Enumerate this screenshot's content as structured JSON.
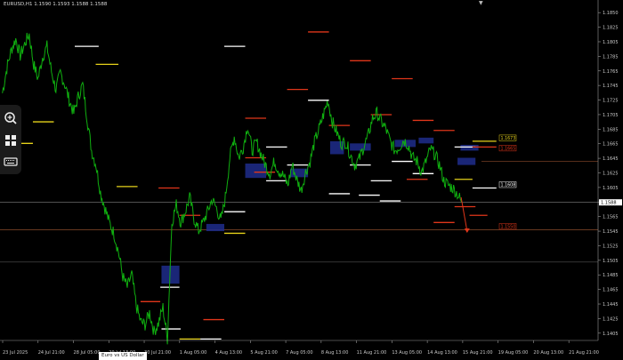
{
  "chart_title": "EURUSD,H1  1.1590 1.1593 1.1588 1.1588",
  "tooltip": "Euro vs US Dollar",
  "colors": {
    "background": "#000000",
    "price_line": "#10b010",
    "zone_fill": "#1e2d8c",
    "axis_text": "#c8c8c8",
    "grid_line": "#808080",
    "yellow_level": "#e6d21a",
    "red_level": "#e0361a",
    "white_level": "#ffffff"
  },
  "toolbar": {
    "icons": [
      "zoom-in-icon",
      "grid-icon",
      "keyboard-icon"
    ]
  },
  "chart_data": {
    "type": "line",
    "symbol": "EURUSD",
    "timeframe": "H1",
    "ohlc": {
      "open": 1.159,
      "high": 1.1593,
      "low": 1.1588,
      "close": 1.1588
    },
    "ylim": [
      1.1396,
      1.1862
    ],
    "y_ticks": [
      "1.1850",
      "1.1825",
      "1.1805",
      "1.1785",
      "1.1765",
      "1.1745",
      "1.1725",
      "1.1705",
      "1.1685",
      "1.1665",
      "1.1645",
      "1.1625",
      "1.1605",
      "1.1585",
      "1.1565",
      "1.1545",
      "1.1525",
      "1.1505",
      "1.1485",
      "1.1465",
      "1.1445",
      "1.1425",
      "1.1405"
    ],
    "x_labels": [
      "23 Jul 2025",
      "24 Jul 21:00",
      "28 Jul 05:00",
      "29 Jul 13:00",
      "30 Jul 21:00",
      "1 Aug 05:00",
      "4 Aug 13:00",
      "5 Aug 21:00",
      "7 Aug 05:00",
      "8 Aug 13:00",
      "11 Aug 21:00",
      "13 Aug 05:00",
      "14 Aug 13:00",
      "15 Aug 21:00",
      "19 Aug 05:00",
      "20 Aug 13:00",
      "21 Aug 21:00"
    ],
    "price_labels": [
      {
        "value": 1.1673,
        "text": "1.1673",
        "color": "#e6d21a"
      },
      {
        "value": 1.1665,
        "text": "1.1665",
        "color": "#e0361a"
      },
      {
        "value": 1.1608,
        "text": "1.1608",
        "color": "#ffffff"
      },
      {
        "value": 1.1588,
        "text": "1.1588",
        "color": "#ffffff"
      },
      {
        "value": 1.155,
        "text": "1.1550",
        "color": "#e0361a"
      }
    ],
    "series": [
      {
        "values": [
          1.174,
          1.1775,
          1.18,
          1.1815,
          1.1792,
          1.1808,
          1.1822,
          1.178,
          1.176,
          1.179,
          1.1805,
          1.177,
          1.1745,
          1.1768,
          1.1752,
          1.173,
          1.1712,
          1.1735,
          1.1752,
          1.1705,
          1.166,
          1.164,
          1.1602,
          1.158,
          1.156,
          1.1545,
          1.152,
          1.1485,
          1.147,
          1.1488,
          1.1445,
          1.1422,
          1.1418,
          1.1435,
          1.1408,
          1.142,
          1.1442,
          1.1398,
          1.156,
          1.1585,
          1.156,
          1.1575,
          1.1595,
          1.1565,
          1.1548,
          1.156,
          1.1575,
          1.1592,
          1.158,
          1.1562,
          1.1595,
          1.165,
          1.168,
          1.165,
          1.1665,
          1.1695,
          1.166,
          1.1672,
          1.1655,
          1.164,
          1.1628,
          1.1645,
          1.1632,
          1.1625,
          1.1612,
          1.164,
          1.162,
          1.1605,
          1.163,
          1.1645,
          1.1672,
          1.169,
          1.171,
          1.173,
          1.17,
          1.1685,
          1.167,
          1.1672,
          1.1655,
          1.164,
          1.1648,
          1.1665,
          1.168,
          1.1705,
          1.1712,
          1.17,
          1.169,
          1.1672,
          1.166,
          1.1665,
          1.1675,
          1.1668,
          1.165,
          1.1645,
          1.163,
          1.1645,
          1.1662,
          1.1655,
          1.164,
          1.1618,
          1.1612,
          1.1608,
          1.16,
          1.1588
        ]
      }
    ],
    "zones": [
      {
        "start": 0.41,
        "end": 0.445,
        "low": 1.1622,
        "high": 1.1642
      },
      {
        "start": 0.485,
        "end": 0.515,
        "low": 1.1623,
        "high": 1.1635
      },
      {
        "start": 0.552,
        "end": 0.575,
        "low": 1.1655,
        "high": 1.1673
      },
      {
        "start": 0.585,
        "end": 0.62,
        "low": 1.166,
        "high": 1.167
      },
      {
        "start": 0.66,
        "end": 0.695,
        "low": 1.1665,
        "high": 1.1675
      },
      {
        "start": 0.7,
        "end": 0.725,
        "low": 1.167,
        "high": 1.1678
      },
      {
        "start": 0.77,
        "end": 0.8,
        "low": 1.166,
        "high": 1.1668
      },
      {
        "start": 0.345,
        "end": 0.375,
        "low": 1.1548,
        "high": 1.1558
      },
      {
        "start": 0.27,
        "end": 0.3,
        "low": 1.1475,
        "high": 1.15
      },
      {
        "start": 0.765,
        "end": 0.795,
        "low": 1.164,
        "high": 1.165
      }
    ],
    "levels": [
      {
        "start": 0.125,
        "end": 0.165,
        "value": 1.1805,
        "color": "#ffffff"
      },
      {
        "start": 0.16,
        "end": 0.198,
        "value": 1.178,
        "color": "#e6d21a"
      },
      {
        "start": 0.055,
        "end": 0.09,
        "value": 1.17,
        "color": "#e6d21a"
      },
      {
        "start": 0.025,
        "end": 0.055,
        "value": 1.167,
        "color": "#e6d21a"
      },
      {
        "start": 0.195,
        "end": 0.23,
        "value": 1.161,
        "color": "#e6d21a"
      },
      {
        "start": 0.265,
        "end": 0.3,
        "value": 1.1608,
        "color": "#e0361a"
      },
      {
        "start": 0.3,
        "end": 0.335,
        "value": 1.157,
        "color": "#e0361a"
      },
      {
        "start": 0.235,
        "end": 0.268,
        "value": 1.145,
        "color": "#e0361a"
      },
      {
        "start": 0.268,
        "end": 0.3,
        "value": 1.147,
        "color": "#ffffff"
      },
      {
        "start": 0.27,
        "end": 0.302,
        "value": 1.1412,
        "color": "#ffffff"
      },
      {
        "start": 0.34,
        "end": 0.375,
        "value": 1.1425,
        "color": "#e0361a"
      },
      {
        "start": 0.3,
        "end": 0.335,
        "value": 1.1398,
        "color": "#e6d21a"
      },
      {
        "start": 0.335,
        "end": 0.37,
        "value": 1.1398,
        "color": "#ffffff"
      },
      {
        "start": 0.375,
        "end": 0.41,
        "value": 1.1545,
        "color": "#e6d21a"
      },
      {
        "start": 0.375,
        "end": 0.41,
        "value": 1.1575,
        "color": "#ffffff"
      },
      {
        "start": 0.375,
        "end": 0.41,
        "value": 1.1805,
        "color": "#ffffff"
      },
      {
        "start": 0.41,
        "end": 0.445,
        "value": 1.165,
        "color": "#e0361a"
      },
      {
        "start": 0.41,
        "end": 0.445,
        "value": 1.1705,
        "color": "#e0361a"
      },
      {
        "start": 0.445,
        "end": 0.48,
        "value": 1.1618,
        "color": "#ffffff"
      },
      {
        "start": 0.445,
        "end": 0.48,
        "value": 1.1665,
        "color": "#ffffff"
      },
      {
        "start": 0.48,
        "end": 0.515,
        "value": 1.1745,
        "color": "#e0361a"
      },
      {
        "start": 0.48,
        "end": 0.515,
        "value": 1.164,
        "color": "#ffffff"
      },
      {
        "start": 0.515,
        "end": 0.55,
        "value": 1.1825,
        "color": "#e0361a"
      },
      {
        "start": 0.515,
        "end": 0.55,
        "value": 1.173,
        "color": "#ffffff"
      },
      {
        "start": 0.55,
        "end": 0.585,
        "value": 1.1695,
        "color": "#e0361a"
      },
      {
        "start": 0.55,
        "end": 0.585,
        "value": 1.16,
        "color": "#ffffff"
      },
      {
        "start": 0.585,
        "end": 0.62,
        "value": 1.1785,
        "color": "#e0361a"
      },
      {
        "start": 0.585,
        "end": 0.62,
        "value": 1.164,
        "color": "#ffffff"
      },
      {
        "start": 0.62,
        "end": 0.655,
        "value": 1.171,
        "color": "#e0361a"
      },
      {
        "start": 0.62,
        "end": 0.655,
        "value": 1.1618,
        "color": "#ffffff"
      },
      {
        "start": 0.655,
        "end": 0.69,
        "value": 1.176,
        "color": "#e0361a"
      },
      {
        "start": 0.655,
        "end": 0.69,
        "value": 1.1645,
        "color": "#ffffff"
      },
      {
        "start": 0.69,
        "end": 0.725,
        "value": 1.1702,
        "color": "#e0361a"
      },
      {
        "start": 0.69,
        "end": 0.725,
        "value": 1.1628,
        "color": "#ffffff"
      },
      {
        "start": 0.725,
        "end": 0.76,
        "value": 1.156,
        "color": "#e0361a"
      },
      {
        "start": 0.725,
        "end": 0.76,
        "value": 1.1688,
        "color": "#e0361a"
      },
      {
        "start": 0.76,
        "end": 0.795,
        "value": 1.1665,
        "color": "#ffffff"
      },
      {
        "start": 0.76,
        "end": 0.795,
        "value": 1.1582,
        "color": "#e0361a"
      },
      {
        "start": 0.425,
        "end": 0.46,
        "value": 1.163,
        "color": "#e0361a"
      },
      {
        "start": 0.6,
        "end": 0.635,
        "value": 1.1598,
        "color": "#ffffff"
      },
      {
        "start": 0.635,
        "end": 0.67,
        "value": 1.159,
        "color": "#ffffff"
      },
      {
        "start": 0.68,
        "end": 0.715,
        "value": 1.162,
        "color": "#e0361a"
      },
      {
        "start": 0.76,
        "end": 0.79,
        "value": 1.162,
        "color": "#e6d21a"
      },
      {
        "start": 0.79,
        "end": 0.83,
        "value": 1.1673,
        "color": "#e6d21a"
      },
      {
        "start": 0.79,
        "end": 0.83,
        "value": 1.1665,
        "color": "#e0361a"
      },
      {
        "start": 0.79,
        "end": 0.83,
        "value": 1.1608,
        "color": "#ffffff"
      },
      {
        "start": 0.785,
        "end": 0.815,
        "value": 1.157,
        "color": "#e0361a"
      }
    ],
    "horizontal_lines": [
      {
        "value": 1.1588,
        "color": "#808080"
      },
      {
        "value": 1.155,
        "color": "#8a4a2a"
      },
      {
        "value": 1.1505,
        "color": "#555555"
      }
    ],
    "hline_partial": [
      {
        "start": 0.805,
        "value": 1.1645,
        "color": "#8a4a2a"
      }
    ],
    "arrow": {
      "from_x": 0.771,
      "from_value": 1.1595,
      "to_x": 0.781,
      "to_value": 1.1548
    }
  }
}
